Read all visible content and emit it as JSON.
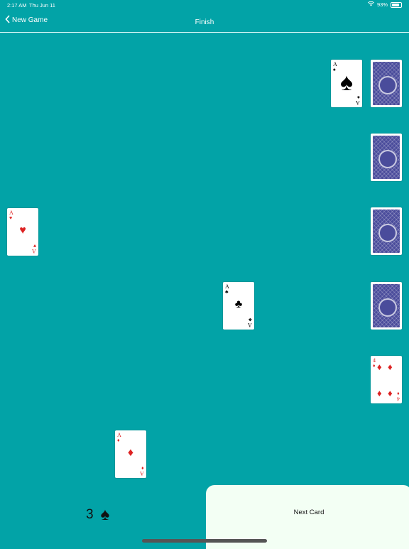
{
  "status_bar": {
    "time": "2:17 AM",
    "date": "Thu Jun 11",
    "battery": "93%"
  },
  "nav": {
    "back_label": "New Game",
    "title": "Finish"
  },
  "cards": {
    "top_ace_spades": {
      "rank": "A",
      "suit": "♠"
    },
    "ace_hearts": {
      "rank": "A",
      "suit": "♥"
    },
    "ace_clubs": {
      "rank": "A",
      "suit": "♣"
    },
    "ace_diamonds": {
      "rank": "A",
      "suit": "♦"
    },
    "four_diamonds": {
      "rank": "4",
      "suit": "♦"
    }
  },
  "counter": {
    "value": "3",
    "suit": "♠"
  },
  "next_card_button": {
    "label": "Next Card"
  },
  "colors": {
    "table": "#02a3a7",
    "card_back": "#4a4c9b",
    "button_bg": "#f3fff4",
    "red_suit": "#dd2222"
  }
}
